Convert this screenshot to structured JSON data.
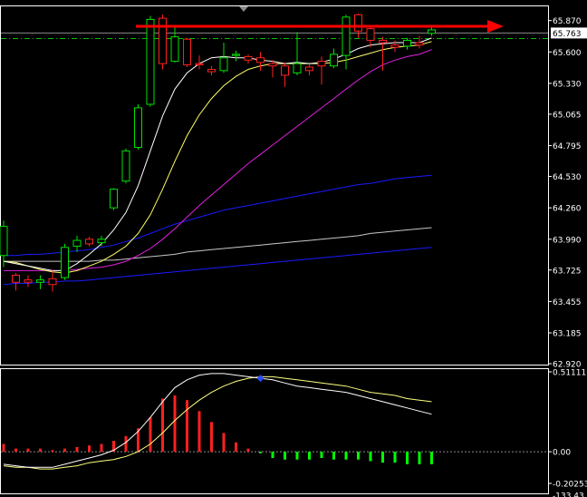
{
  "colors": {
    "background": "#000000",
    "frame": "#ffffff",
    "bull": "#00e000",
    "bear": "#ff2020",
    "ma_fast": "#ffffff",
    "ma_mid": "#ffff66",
    "ma_slow": "#e020e0",
    "ma_blue": "#1a1aff",
    "ma_gray": "#c8c8c8",
    "arrow": "#ff0000",
    "price_line": "#00c000",
    "current_line": "#8a8a8a",
    "macd_pos": "#ff2020",
    "macd_neg": "#00ff00",
    "macd_signal": "#ffff80",
    "macd_line": "#ffffff"
  },
  "chart_data": [
    {
      "type": "candlestick",
      "ylim": [
        62.92,
        66.0
      ],
      "y_ticks": [
        "65.870",
        "65.600",
        "65.330",
        "65.065",
        "64.795",
        "64.530",
        "64.260",
        "63.990",
        "63.725",
        "63.455",
        "63.185",
        "62.920"
      ],
      "y_tick_values": [
        65.87,
        65.6,
        65.33,
        65.065,
        64.795,
        64.53,
        64.26,
        63.99,
        63.725,
        63.455,
        63.185,
        62.92
      ],
      "current_price": "65.763",
      "current_price_value": 65.763,
      "dashed_level": 65.715,
      "candles": [
        {
          "o": 63.85,
          "h": 64.15,
          "l": 63.75,
          "c": 64.1
        },
        {
          "o": 63.68,
          "h": 63.7,
          "l": 63.55,
          "c": 63.62
        },
        {
          "o": 63.64,
          "h": 63.68,
          "l": 63.58,
          "c": 63.62
        },
        {
          "o": 63.62,
          "h": 63.68,
          "l": 63.56,
          "c": 63.64
        },
        {
          "o": 63.65,
          "h": 63.72,
          "l": 63.54,
          "c": 63.6
        },
        {
          "o": 63.66,
          "h": 63.95,
          "l": 63.64,
          "c": 63.92
        },
        {
          "o": 63.93,
          "h": 64.02,
          "l": 63.88,
          "c": 63.98
        },
        {
          "o": 63.99,
          "h": 64.01,
          "l": 63.93,
          "c": 63.95
        },
        {
          "o": 63.96,
          "h": 64.02,
          "l": 63.93,
          "c": 63.99
        },
        {
          "o": 64.26,
          "h": 64.43,
          "l": 64.24,
          "c": 64.42
        },
        {
          "o": 64.49,
          "h": 64.77,
          "l": 64.47,
          "c": 64.75
        },
        {
          "o": 64.78,
          "h": 65.15,
          "l": 64.76,
          "c": 65.12
        },
        {
          "o": 65.15,
          "h": 65.91,
          "l": 65.13,
          "c": 65.88
        },
        {
          "o": 65.89,
          "h": 65.92,
          "l": 65.45,
          "c": 65.5
        },
        {
          "o": 65.52,
          "h": 65.82,
          "l": 65.51,
          "c": 65.73
        },
        {
          "o": 65.71,
          "h": 65.72,
          "l": 65.47,
          "c": 65.49
        },
        {
          "o": 65.5,
          "h": 65.57,
          "l": 65.45,
          "c": 65.49
        },
        {
          "o": 65.45,
          "h": 65.48,
          "l": 65.4,
          "c": 65.43
        },
        {
          "o": 65.44,
          "h": 65.68,
          "l": 65.42,
          "c": 65.55
        },
        {
          "o": 65.57,
          "h": 65.61,
          "l": 65.52,
          "c": 65.58
        },
        {
          "o": 65.56,
          "h": 65.58,
          "l": 65.5,
          "c": 65.53
        },
        {
          "o": 65.55,
          "h": 65.6,
          "l": 65.44,
          "c": 65.51
        },
        {
          "o": 65.5,
          "h": 65.53,
          "l": 65.38,
          "c": 65.48
        },
        {
          "o": 65.48,
          "h": 65.51,
          "l": 65.3,
          "c": 65.4
        },
        {
          "o": 65.42,
          "h": 65.77,
          "l": 65.4,
          "c": 65.5
        },
        {
          "o": 65.47,
          "h": 65.49,
          "l": 65.4,
          "c": 65.44
        },
        {
          "o": 65.52,
          "h": 65.56,
          "l": 65.32,
          "c": 65.48
        },
        {
          "o": 65.48,
          "h": 65.63,
          "l": 65.46,
          "c": 65.58
        },
        {
          "o": 65.57,
          "h": 65.92,
          "l": 65.45,
          "c": 65.9
        },
        {
          "o": 65.92,
          "h": 65.93,
          "l": 65.72,
          "c": 65.78
        },
        {
          "o": 65.8,
          "h": 65.82,
          "l": 65.64,
          "c": 65.7
        },
        {
          "o": 65.7,
          "h": 65.73,
          "l": 65.44,
          "c": 65.68
        },
        {
          "o": 65.66,
          "h": 65.7,
          "l": 65.6,
          "c": 65.64
        },
        {
          "o": 65.65,
          "h": 65.72,
          "l": 65.62,
          "c": 65.7
        },
        {
          "o": 65.68,
          "h": 65.74,
          "l": 65.63,
          "c": 65.66
        },
        {
          "o": 65.76,
          "h": 65.82,
          "l": 65.74,
          "c": 65.79
        }
      ],
      "ma_fast": [
        63.8,
        63.78,
        63.76,
        63.74,
        63.72,
        63.72,
        63.78,
        63.86,
        63.95,
        64.07,
        64.22,
        64.45,
        64.75,
        65.05,
        65.28,
        65.42,
        65.5,
        65.55,
        65.56,
        65.55,
        65.55,
        65.53,
        65.52,
        65.5,
        65.51,
        65.5,
        65.51,
        65.54,
        65.58,
        65.63,
        65.66,
        65.67,
        65.68,
        65.68,
        65.68,
        65.72
      ],
      "ma_mid": [
        63.8,
        63.79,
        63.76,
        63.73,
        63.71,
        63.7,
        63.72,
        63.76,
        63.8,
        63.86,
        63.93,
        64.04,
        64.2,
        64.42,
        64.66,
        64.88,
        65.06,
        65.2,
        65.31,
        65.39,
        65.45,
        65.48,
        65.5,
        65.5,
        65.5,
        65.5,
        65.5,
        65.51,
        65.53,
        65.56,
        65.59,
        65.62,
        65.64,
        65.65,
        65.66,
        65.69
      ],
      "ma_slow": [
        63.72,
        63.72,
        63.72,
        63.72,
        63.72,
        63.72,
        63.73,
        63.74,
        63.75,
        63.77,
        63.8,
        63.85,
        63.91,
        63.99,
        64.08,
        64.18,
        64.28,
        64.37,
        64.46,
        64.55,
        64.64,
        64.72,
        64.8,
        64.88,
        64.96,
        65.04,
        65.12,
        65.2,
        65.28,
        65.36,
        65.43,
        65.49,
        65.53,
        65.56,
        65.58,
        65.62
      ],
      "ma_blue": [
        63.85,
        63.85,
        63.86,
        63.86,
        63.87,
        63.88,
        63.89,
        63.9,
        63.92,
        63.94,
        63.97,
        64.0,
        64.04,
        64.08,
        64.12,
        64.15,
        64.18,
        64.21,
        64.24,
        64.26,
        64.28,
        64.3,
        64.32,
        64.34,
        64.36,
        64.38,
        64.4,
        64.42,
        64.44,
        64.46,
        64.47,
        64.49,
        64.51,
        64.52,
        64.53,
        64.54
      ],
      "ma_gray": [
        63.8,
        63.8,
        63.8,
        63.8,
        63.8,
        63.8,
        63.8,
        63.8,
        63.81,
        63.81,
        63.82,
        63.83,
        63.84,
        63.85,
        63.86,
        63.88,
        63.89,
        63.9,
        63.91,
        63.92,
        63.93,
        63.94,
        63.95,
        63.96,
        63.97,
        63.98,
        63.99,
        64.0,
        64.01,
        64.02,
        64.04,
        64.05,
        64.06,
        64.07,
        64.08,
        64.09
      ],
      "ma_blue2": [
        63.6,
        63.61,
        63.61,
        63.62,
        63.62,
        63.63,
        63.63,
        63.64,
        63.65,
        63.66,
        63.67,
        63.68,
        63.69,
        63.7,
        63.71,
        63.72,
        63.73,
        63.74,
        63.75,
        63.76,
        63.77,
        63.78,
        63.79,
        63.8,
        63.81,
        63.82,
        63.83,
        63.84,
        63.85,
        63.86,
        63.87,
        63.88,
        63.89,
        63.9,
        63.91,
        63.92
      ]
    },
    {
      "type": "bar",
      "ylim": [
        -0.20253,
        0.51111
      ],
      "y_ticks": [
        "0.51111",
        "0.00",
        "-0.20253",
        "-133.43"
      ],
      "y_tick_values": [
        0.51111,
        0.0,
        -0.20253
      ],
      "histogram": [
        0.05,
        0.02,
        0.02,
        0.02,
        0.01,
        0.02,
        0.03,
        0.04,
        0.05,
        0.07,
        0.1,
        0.15,
        0.22,
        0.34,
        0.36,
        0.33,
        0.26,
        0.19,
        0.12,
        0.06,
        0.02,
        -0.01,
        -0.04,
        -0.05,
        -0.05,
        -0.05,
        -0.04,
        -0.05,
        -0.05,
        -0.05,
        -0.06,
        -0.07,
        -0.07,
        -0.08,
        -0.08,
        -0.08
      ],
      "signal": [
        -0.09,
        -0.1,
        -0.1,
        -0.11,
        -0.11,
        -0.1,
        -0.09,
        -0.07,
        -0.06,
        -0.05,
        -0.03,
        0.0,
        0.05,
        0.12,
        0.2,
        0.27,
        0.33,
        0.38,
        0.42,
        0.45,
        0.47,
        0.48,
        0.48,
        0.47,
        0.46,
        0.45,
        0.44,
        0.43,
        0.42,
        0.4,
        0.38,
        0.37,
        0.36,
        0.34,
        0.33,
        0.32
      ],
      "macd_line": [
        -0.08,
        -0.09,
        -0.1,
        -0.1,
        -0.1,
        -0.08,
        -0.06,
        -0.04,
        -0.02,
        0.01,
        0.06,
        0.13,
        0.22,
        0.32,
        0.41,
        0.46,
        0.49,
        0.5,
        0.5,
        0.49,
        0.48,
        0.47,
        0.46,
        0.44,
        0.42,
        0.41,
        0.4,
        0.39,
        0.38,
        0.36,
        0.34,
        0.32,
        0.3,
        0.28,
        0.26,
        0.24
      ],
      "cross_index": 21
    }
  ]
}
